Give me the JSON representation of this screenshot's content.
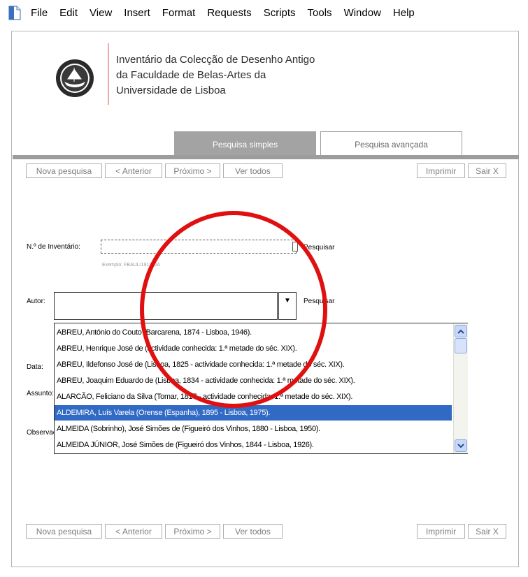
{
  "menu": [
    "File",
    "Edit",
    "View",
    "Insert",
    "Format",
    "Requests",
    "Scripts",
    "Tools",
    "Window",
    "Help"
  ],
  "header": {
    "title_lines": [
      "Inventário da Colecção de Desenho Antigo",
      "da Faculdade de Belas-Artes da",
      "Universidade de Lisboa"
    ]
  },
  "tabs": {
    "simple": "Pesquisa simples",
    "advanced": "Pesquisa avançada"
  },
  "toolbar": {
    "new_search": "Nova pesquisa",
    "previous": "< Anterior",
    "next": "Próximo >",
    "show_all": "Ver todos",
    "print": "Imprimir",
    "exit": "Sair X"
  },
  "form": {
    "inventory_label": "N.º de Inventário:",
    "inventory_value": "",
    "search_link": "Pesquisar",
    "inventory_hint": "Exemplo: FBAUL/1917/DA",
    "author_label": "Autor:",
    "author_value": "",
    "date_label": "Data:",
    "subject_label": "Assunto:",
    "notes_label": "Observações:"
  },
  "author_options": [
    "ABREU, António do Couto (Barcarena, 1874 - Lisboa, 1946).",
    "ABREU, Henrique José de (actividade conhecida: 1.ª metade do séc. XIX).",
    "ABREU, Ildefonso José de (Lisboa, 1825 - actividade conhecida: 1.ª metade do séc. XIX).",
    "ABREU, Joaquim Eduardo de (Lisboa, 1834 - actividade conhecida: 1.ª metade do séc. XIX).",
    "ALARCÃO, Feliciano da Silva (Tomar, 1817 - actividade conhecida: 1.ª metade do séc. XIX).",
    "ALDEMIRA, Luís Varela (Orense (Espanha), 1895 - Lisboa, 1975).",
    "ALMEIDA (Sobrinho), José Simões de (Figueiró dos Vinhos, 1880 - Lisboa, 1950).",
    "ALMEIDA JÚNIOR, José Simões de (Figueiró dos Vinhos, 1844 - Lisboa, 1926)."
  ],
  "selected_option_index": 5,
  "colors": {
    "highlight": "#316ac5",
    "annotation_circle": "#e01010",
    "tab_active": "#a3a3a3"
  }
}
